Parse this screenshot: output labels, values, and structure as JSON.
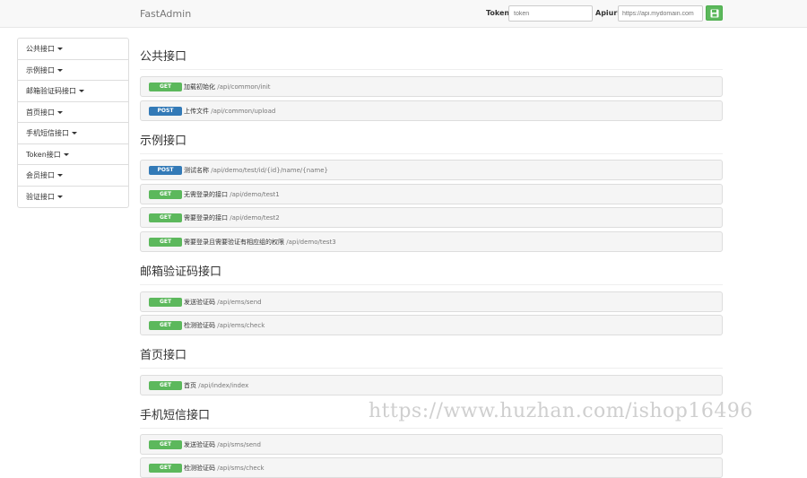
{
  "header": {
    "brand": "FastAdmin",
    "token_label": "Token:",
    "token_placeholder": "token",
    "apiurl_label": "Apiurl:",
    "apiurl_placeholder": "https://api.mydomain.com",
    "save_icon": "floppy-disk-icon",
    "save_color": "#5cb85c"
  },
  "sidebar": {
    "items": [
      {
        "label": "公共接口"
      },
      {
        "label": "示例接口"
      },
      {
        "label": "邮箱验证码接口"
      },
      {
        "label": "首页接口"
      },
      {
        "label": "手机短信接口"
      },
      {
        "label": "Token接口"
      },
      {
        "label": "会员接口"
      },
      {
        "label": "验证接口"
      }
    ]
  },
  "sections": [
    {
      "title": "公共接口",
      "apis": [
        {
          "method": "GET",
          "name": "加载初始化",
          "path": "/api/common/init"
        },
        {
          "method": "POST",
          "name": "上传文件",
          "path": "/api/common/upload"
        }
      ]
    },
    {
      "title": "示例接口",
      "apis": [
        {
          "method": "POST",
          "name": "测试名称",
          "path": "/api/demo/test/id/{id}/name/{name}"
        },
        {
          "method": "GET",
          "name": "无需登录的接口",
          "path": "/api/demo/test1"
        },
        {
          "method": "GET",
          "name": "需要登录的接口",
          "path": "/api/demo/test2"
        },
        {
          "method": "GET",
          "name": "需要登录且需要验证有相应组的权限",
          "path": "/api/demo/test3"
        }
      ]
    },
    {
      "title": "邮箱验证码接口",
      "apis": [
        {
          "method": "GET",
          "name": "发送验证码",
          "path": "/api/ems/send"
        },
        {
          "method": "GET",
          "name": "检测验证码",
          "path": "/api/ems/check"
        }
      ]
    },
    {
      "title": "首页接口",
      "apis": [
        {
          "method": "GET",
          "name": "首页",
          "path": "/api/index/index"
        }
      ]
    },
    {
      "title": "手机短信接口",
      "apis": [
        {
          "method": "GET",
          "name": "发送验证码",
          "path": "/api/sms/send"
        },
        {
          "method": "GET",
          "name": "检测验证码",
          "path": "/api/sms/check"
        }
      ]
    }
  ],
  "colors": {
    "get": "#5cb85c",
    "post": "#337ab7"
  },
  "watermark": "https://www.huzhan.com/ishop16496"
}
